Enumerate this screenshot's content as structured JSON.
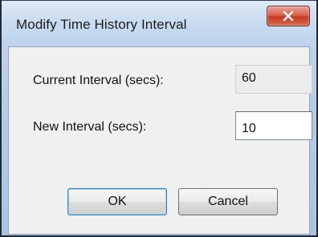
{
  "window": {
    "title": "Modify Time History Interval"
  },
  "titlebar": {
    "close_label": "X"
  },
  "fields": {
    "current_label": "Current Interval (secs):",
    "current_value": "60",
    "new_label": "New Interval (secs):",
    "new_value": "10"
  },
  "buttons": {
    "ok_label": "OK",
    "cancel_label": "Cancel"
  },
  "colors": {
    "close_button": "#d9634f",
    "ok_focus_border": "#3c7fb1",
    "dialog_background": "#f0f0f0"
  }
}
